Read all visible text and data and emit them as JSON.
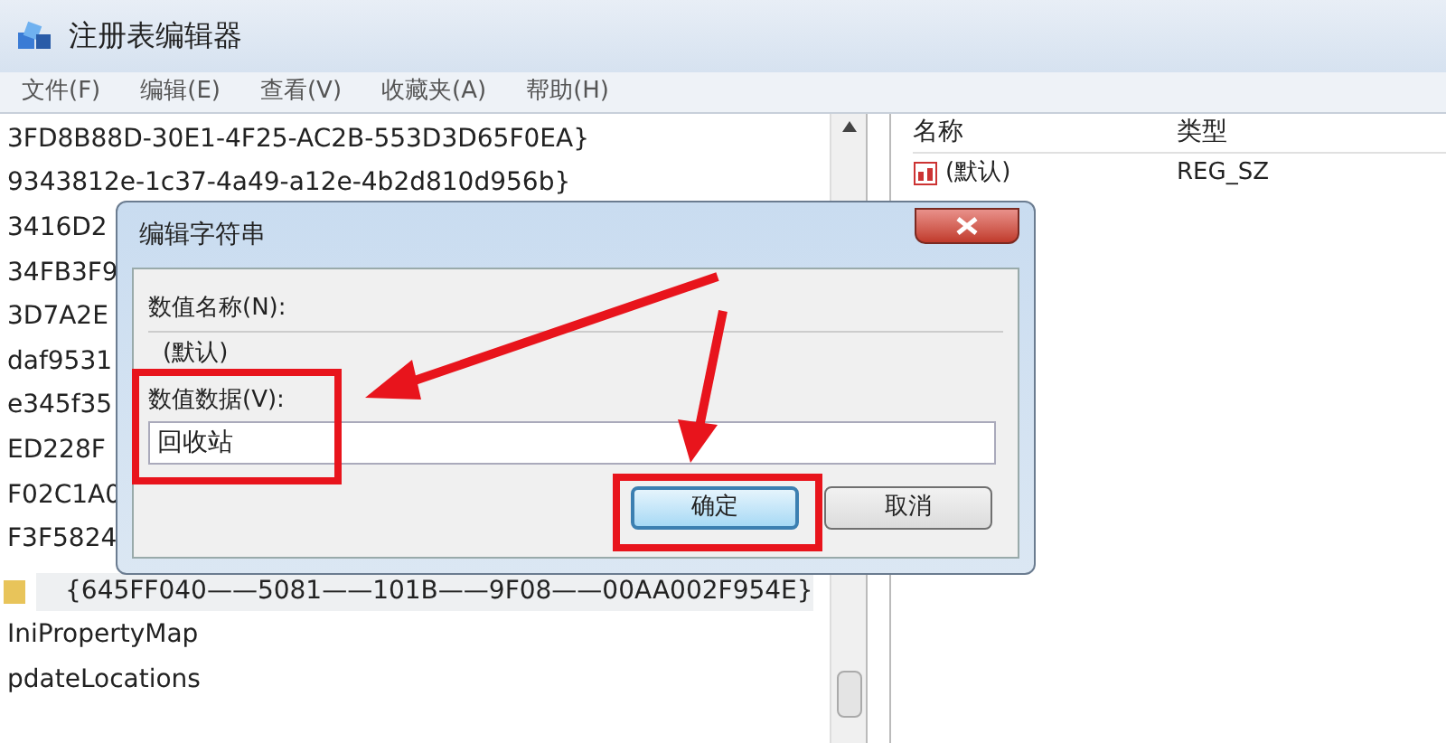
{
  "window": {
    "title": "注册表编辑器"
  },
  "menu": [
    "文件(F)",
    "编辑(E)",
    "查看(V)",
    "收藏夹(A)",
    "帮助(H)"
  ],
  "tree": [
    {
      "label": "3FD8B88D-30E1-4F25-AC2B-553D3D65F0EA}",
      "kind": "key",
      "selected": false
    },
    {
      "label": "9343812e-1c37-4a49-a12e-4b2d810d956b}",
      "kind": "key",
      "selected": false
    },
    {
      "label": "3416D2",
      "kind": "key",
      "selected": false
    },
    {
      "label": "34FB3F9",
      "kind": "key",
      "selected": false
    },
    {
      "label": "3D7A2E",
      "kind": "key",
      "selected": false
    },
    {
      "label": "daf9531",
      "kind": "key",
      "selected": false
    },
    {
      "label": "e345f35",
      "kind": "key",
      "selected": false
    },
    {
      "label": "ED228F",
      "kind": "key",
      "selected": false
    },
    {
      "label": "F02C1A0",
      "kind": "key",
      "selected": false
    },
    {
      "label": "F3F5824",
      "kind": "key",
      "selected": false
    },
    {
      "label": "{645FF040——5081——101B——9F08——00AA002F954E}",
      "kind": "folder",
      "selected": true
    },
    {
      "label": "IniPropertyMap",
      "kind": "key",
      "selected": false
    },
    {
      "label": "pdateLocations",
      "kind": "key",
      "selected": false
    }
  ],
  "values": {
    "columns": [
      "名称",
      "类型"
    ],
    "rows": [
      {
        "name": "(默认)",
        "type": "REG_SZ"
      }
    ]
  },
  "dialog": {
    "title": "编辑字符串",
    "name_label": "数值名称(N):",
    "name_value": "(默认)",
    "data_label": "数值数据(V):",
    "data_value": "回收站",
    "buttons": [
      {
        "label": "确定",
        "selected": true
      },
      {
        "label": "取消",
        "selected": false
      }
    ]
  }
}
